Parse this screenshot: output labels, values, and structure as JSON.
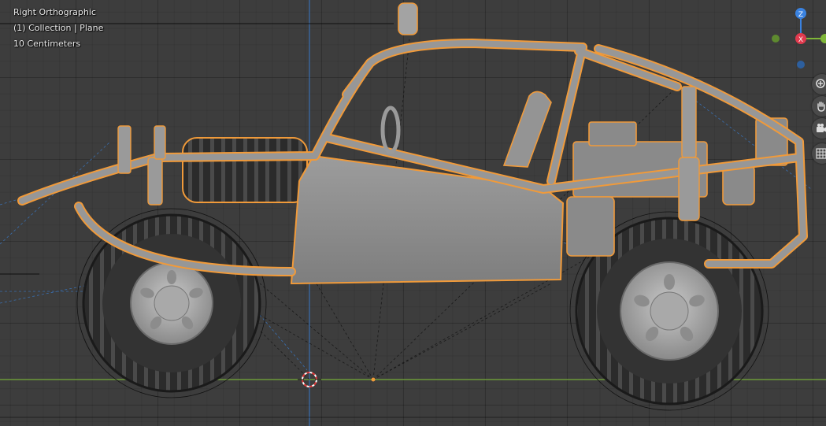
{
  "viewport": {
    "view_name": "Right Orthographic",
    "collection_info": "(1) Collection | Plane",
    "grid_scale": "10 Centimeters"
  },
  "gizmo": {
    "z_label": "Z",
    "x_label": "X",
    "colors": {
      "x": "#e03a4e",
      "y": "#7fb638",
      "z": "#3a82e0"
    }
  },
  "nav_buttons": [
    "zoom-icon",
    "hand-pan-icon",
    "camera-icon",
    "grid-icon"
  ],
  "colors": {
    "selection_outline": "#f09a3a",
    "model": "#8f8f8f",
    "tire": "#2a2a2a",
    "ground_line": "#6d9a3a",
    "blue_axis": "#3a6fb0"
  }
}
